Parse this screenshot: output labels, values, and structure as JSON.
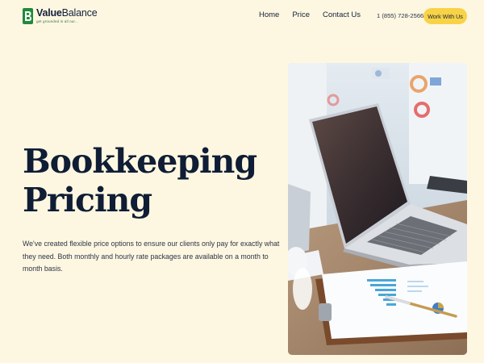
{
  "brand": {
    "name_bold": "Value",
    "name_rest": "Balance",
    "tagline": "get grounded in all our..."
  },
  "nav": {
    "items": [
      "Home",
      "Price",
      "Contact Us"
    ]
  },
  "header": {
    "phone": "1 (855) 728-2566",
    "cta_label": "Work With Us"
  },
  "hero": {
    "title_line1": "Bookkeeping",
    "title_line2": "Pricing",
    "description": "We've created flexible price options to ensure our clients only pay for exactly what they need. Both monthly and hourly rate packages are available on a month to month basis."
  },
  "colors": {
    "background": "#fdf7e1",
    "accent": "#f8d347",
    "brand_green": "#1f8a3c",
    "text": "#0f1d35"
  },
  "icons": {
    "logo": "value-balance-logo-icon"
  }
}
